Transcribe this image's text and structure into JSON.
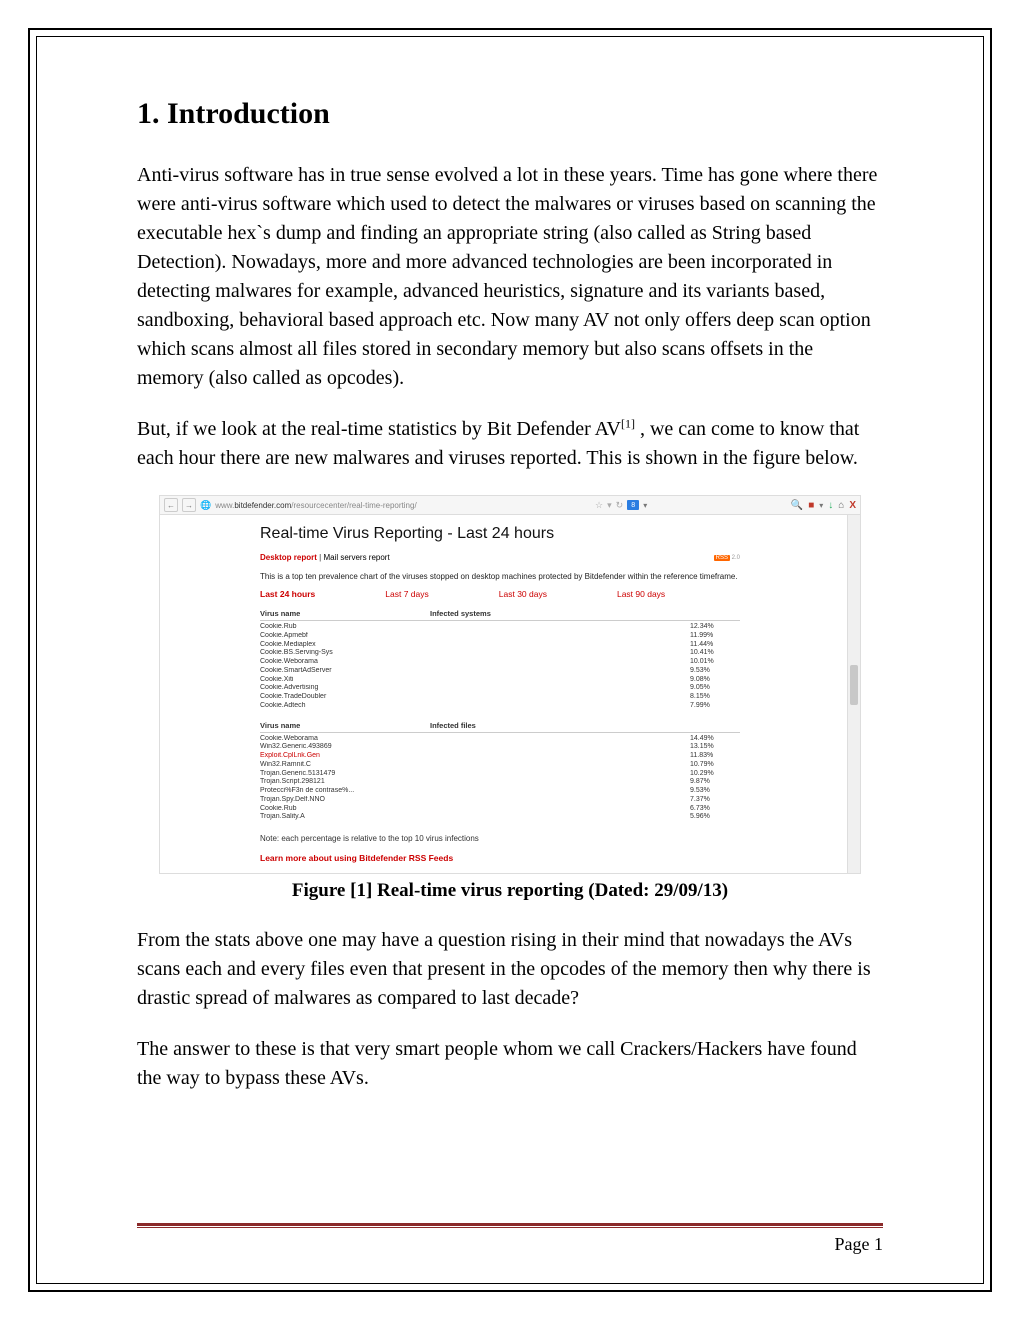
{
  "heading": "1. Introduction",
  "para1": "Anti-virus software has in true sense evolved a lot in these years. Time has gone where there were anti-virus software which used to detect the malwares or viruses based on scanning the executable hex`s dump and finding an appropriate string (also called as String based Detection). Nowadays, more and more advanced technologies are been incorporated in detecting malwares for example, advanced heuristics, signature and its variants based, sandboxing, behavioral based approach etc. Now many AV not only offers deep scan option which scans almost all files stored in secondary memory but also scans offsets in the memory (also called as opcodes).",
  "para2_pre": " But, if we look at the real-time statistics by Bit Defender AV",
  "para2_sup": "[1]",
  "para2_post": " , we can come to know that each hour there are new malwares and viruses reported. This is shown in the figure below.",
  "browser": {
    "url_prefix": "www.",
    "url_domain": "bitdefender.com",
    "url_path": "/resourcecenter/real-time-reporting/",
    "toolbar_icons": {
      "star": "☆",
      "dropdown": "▾",
      "reload": "↻",
      "search_badge": "8",
      "search": "🔍",
      "abp": "■",
      "down": "↓",
      "home": "⌂",
      "close": "X"
    }
  },
  "report": {
    "title": "Real-time Virus Reporting - Last 24 hours",
    "tab_active": "Desktop report",
    "tab_other": "Mail servers report",
    "rss_label": "RSS",
    "rss_version": "2.0",
    "description": "This is a top ten prevalence chart of the viruses stopped on desktop machines protected by Bitdefender within the reference timeframe.",
    "time_tabs": [
      "Last 24 hours",
      "Last 7 days",
      "Last 30 days",
      "Last 90 days"
    ],
    "time_active_index": 0,
    "table1_header_name": "Virus name",
    "table1_header_metric": "Infected systems",
    "table2_header_name": "Virus name",
    "table2_header_metric": "Infected files",
    "note": "Note: each percentage is relative to the top 10 virus infections",
    "rss_link": "Learn more about using Bitdefender RSS Feeds"
  },
  "chart_data": [
    {
      "type": "table",
      "title": "Infected systems",
      "rows": [
        {
          "name": "Cookie.Rub",
          "pct": "12.34%"
        },
        {
          "name": "Cookie.Apmebf",
          "pct": "11.99%"
        },
        {
          "name": "Cookie.Mediaplex",
          "pct": "11.44%"
        },
        {
          "name": "Cookie.BS.Serving-Sys",
          "pct": "10.41%"
        },
        {
          "name": "Cookie.Weborama",
          "pct": "10.01%"
        },
        {
          "name": "Cookie.SmartAdServer",
          "pct": "9.53%"
        },
        {
          "name": "Cookie.Xiti",
          "pct": "9.08%"
        },
        {
          "name": "Cookie.Advertising",
          "pct": "9.05%"
        },
        {
          "name": "Cookie.TradeDoubler",
          "pct": "8.15%"
        },
        {
          "name": "Cookie.Adtech",
          "pct": "7.99%"
        }
      ]
    },
    {
      "type": "table",
      "title": "Infected files",
      "rows": [
        {
          "name": "Cookie.Weborama",
          "pct": "14.49%"
        },
        {
          "name": "Win32.Generic.493869",
          "pct": "13.15%"
        },
        {
          "name": "Exploit.CplLnk.Gen",
          "pct": "11.83%",
          "highlight": true
        },
        {
          "name": "Win32.Ramnit.C",
          "pct": "10.79%"
        },
        {
          "name": "Trojan.Generic.5131479",
          "pct": "10.29%"
        },
        {
          "name": "Trojan.Script.298121",
          "pct": "9.87%"
        },
        {
          "name": "Protecci%F3n de contrase%...",
          "pct": "9.53%"
        },
        {
          "name": "Trojan.Spy.Delf.NNO",
          "pct": "7.37%"
        },
        {
          "name": "Cookie.Rub",
          "pct": "6.73%"
        },
        {
          "name": "Trojan.Sality.A",
          "pct": "5.96%"
        }
      ]
    }
  ],
  "caption": "Figure [1] Real-time virus reporting (Dated: 29/09/13)",
  "para3": "From the stats above one may have a question rising in their mind that nowadays the AVs scans each and every files even that present in the opcodes of the memory then why there is drastic spread of malwares as compared to last decade?",
  "para4": "The answer to these is that very smart people whom we call Crackers/Hackers have found the way to bypass these AVs.",
  "page_label": "Page 1"
}
